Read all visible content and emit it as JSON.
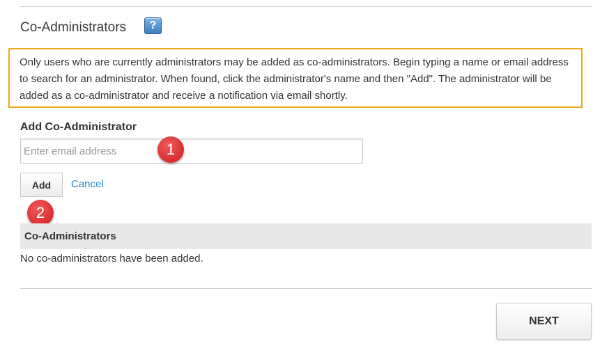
{
  "section": {
    "title": "Co-Administrators",
    "help_icon": "question-mark-icon",
    "help_glyph": "?"
  },
  "info": {
    "text": "Only users who are currently administrators may be added as co-administrators. Begin typing a name or email address to search for an administrator. When found, click the administrator's name and then \"Add\". The administrator will be added as a co-administrator and receive a notification via email shortly.",
    "border_color": "#f0a81e"
  },
  "form": {
    "label": "Add Co-Administrator",
    "email_placeholder": "Enter email address",
    "email_value": "",
    "add_label": "Add",
    "cancel_label": "Cancel"
  },
  "annotations": {
    "badge_1": "1",
    "badge_2": "2",
    "color": "#d62f2f"
  },
  "list": {
    "header": "Co-Administrators",
    "empty_message": "No co-administrators have been added."
  },
  "footer": {
    "next_label": "NEXT"
  },
  "colors": {
    "link": "#2b8cc4",
    "header_bg": "#e8e8e8"
  }
}
